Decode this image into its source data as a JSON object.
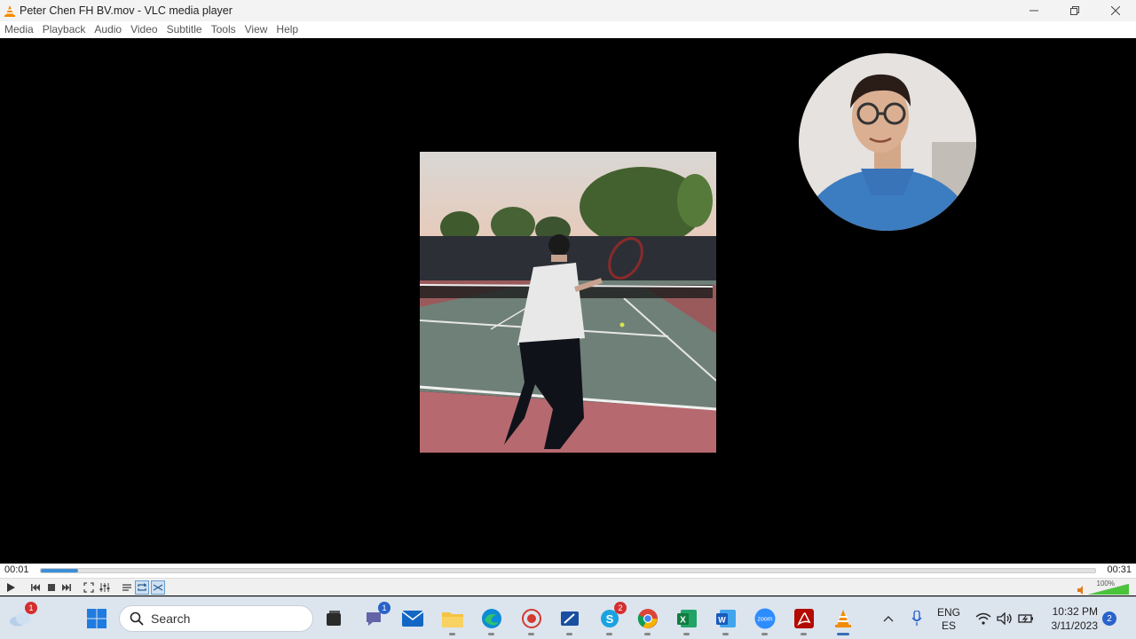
{
  "window": {
    "title": "Peter Chen FH BV.mov - VLC media player",
    "controls": [
      "minimize",
      "maximize",
      "close"
    ]
  },
  "menu": [
    "Media",
    "Playback",
    "Audio",
    "Video",
    "Subtitle",
    "Tools",
    "View",
    "Help"
  ],
  "player": {
    "current_time": "00:01",
    "total_time": "00:31",
    "progress_fraction": 0.035,
    "volume_label": "100%",
    "volume_fraction": 1.0,
    "loop_toggled": true,
    "random_toggled": true
  },
  "taskbar": {
    "search_placeholder": "Search",
    "weather_badge": "1",
    "teams_badge": "1",
    "skype_badge": "2",
    "language_top": "ENG",
    "language_bottom": "ES",
    "time": "10:32 PM",
    "date": "3/11/2023",
    "notification_count": "2"
  },
  "colors": {
    "accent": "#3b8fd6",
    "vlc_orange": "#f28c00",
    "taskbar_bg": "#dce4ee"
  }
}
